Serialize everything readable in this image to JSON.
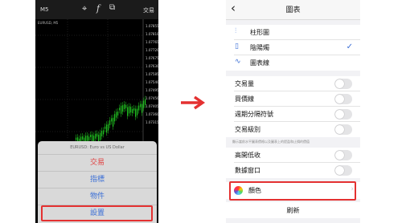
{
  "left_phone": {
    "timeframe": "M5",
    "crosshair_icon": "crosshair-icon",
    "indicator_icon": "f",
    "objects_icon": "objects-icon",
    "trade_label": "交易",
    "symbol_caption": "EURUSD, M5",
    "price_ticks": [
      "1.07855",
      "1.07810",
      "1.07765",
      "1.07720",
      "1.07675",
      "1.07630",
      "1.07585",
      "1.07540",
      "1.07495",
      "1.07450",
      "1.07405",
      "1.07360",
      "1.07315"
    ],
    "action_sheet": {
      "title": "EURUSD: Euro vs US Dollar",
      "items": [
        "交易",
        "指標",
        "物件",
        "設置"
      ]
    }
  },
  "right_phone": {
    "title": "圖表",
    "chart_types": [
      {
        "label": "柱形圖",
        "icon": "bar-chart-icon",
        "selected": false
      },
      {
        "label": "陰陽燭",
        "icon": "candlestick-icon",
        "selected": true
      },
      {
        "label": "圖表線",
        "icon": "line-chart-icon",
        "selected": false
      }
    ],
    "toggles_group1": [
      {
        "label": "交易量",
        "on": false
      },
      {
        "label": "買價線",
        "on": false
      },
      {
        "label": "週期分隔符號",
        "on": false
      },
      {
        "label": "交易級別",
        "on": false
      }
    ],
    "info_text": "顯示當前水平圖表價格以及圖表上的提盈和止損的價值",
    "toggles_group2": [
      {
        "label": "高開低收",
        "on": false
      },
      {
        "label": "數據窗口",
        "on": false
      }
    ],
    "color_label": "顏色",
    "refresh_label": "刷新"
  },
  "colors": {
    "accent_blue": "#3b6fd6",
    "highlight_red": "#e43131",
    "candle_green": "#22c722",
    "chart_background": "#000000"
  }
}
